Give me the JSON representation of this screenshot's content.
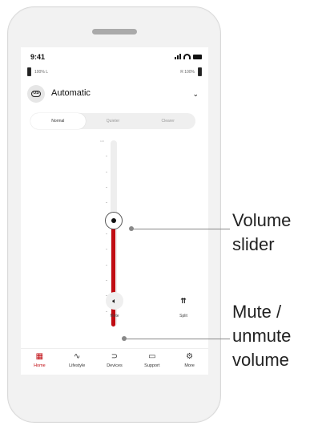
{
  "status": {
    "time": "9:41"
  },
  "hearing_aids": {
    "left": {
      "label": "L",
      "battery": "100%"
    },
    "right": {
      "label": "R",
      "battery": "100%"
    }
  },
  "program": {
    "icon": "program-os-icon",
    "icon_text": "OS",
    "name": "Automatic"
  },
  "modes": [
    "Normal",
    "Quieter",
    "Clearer"
  ],
  "active_mode": "Normal",
  "volume": {
    "level_fraction": 0.57,
    "top_label": "100",
    "knob": "slider-knob"
  },
  "controls": {
    "mute": "Mute",
    "split": "Split"
  },
  "tabs": [
    {
      "label": "Home",
      "icon": "home-grid-icon",
      "glyph": "▦",
      "active": true
    },
    {
      "label": "Lifestyle",
      "icon": "activity-icon",
      "glyph": "∿",
      "active": false
    },
    {
      "label": "Devices",
      "icon": "hearing-aid-icon",
      "glyph": "⊃",
      "active": false
    },
    {
      "label": "Support",
      "icon": "chat-icon",
      "glyph": "▭",
      "active": false
    },
    {
      "label": "More",
      "icon": "gear-icon",
      "glyph": "⚙",
      "active": false
    }
  ],
  "callouts": {
    "volume": "Volume slider",
    "mute": "Mute / unmute volume"
  },
  "colors": {
    "accent": "#c00b12",
    "track": "#eeeeee"
  }
}
